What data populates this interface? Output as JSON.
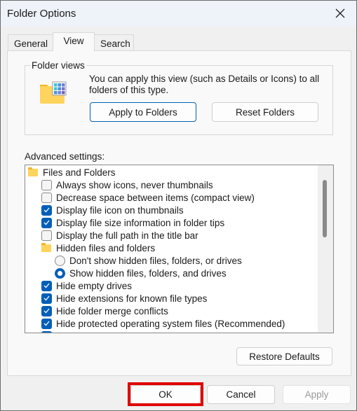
{
  "window": {
    "title": "Folder Options",
    "close_icon": "close-icon"
  },
  "tabs": [
    {
      "label": "General"
    },
    {
      "label": "View",
      "active": true
    },
    {
      "label": "Search"
    }
  ],
  "folder_views": {
    "label": "Folder views",
    "description": "You can apply this view (such as Details or Icons) to all folders of this type.",
    "apply_label": "Apply to Folders",
    "reset_label": "Reset Folders"
  },
  "advanced": {
    "label": "Advanced settings:",
    "items": [
      {
        "type": "folder",
        "label": "Files and Folders",
        "level": 0
      },
      {
        "type": "checkbox",
        "label": "Always show icons, never thumbnails",
        "checked": false,
        "level": 1
      },
      {
        "type": "checkbox",
        "label": "Decrease space between items (compact view)",
        "checked": false,
        "level": 1
      },
      {
        "type": "checkbox",
        "label": "Display file icon on thumbnails",
        "checked": true,
        "level": 1
      },
      {
        "type": "checkbox",
        "label": "Display file size information in folder tips",
        "checked": true,
        "level": 1
      },
      {
        "type": "checkbox",
        "label": "Display the full path in the title bar",
        "checked": false,
        "level": 1
      },
      {
        "type": "folder",
        "label": "Hidden files and folders",
        "level": 1
      },
      {
        "type": "radio",
        "label": "Don't show hidden files, folders, or drives",
        "checked": false,
        "level": 2
      },
      {
        "type": "radio",
        "label": "Show hidden files, folders, and drives",
        "checked": true,
        "level": 2
      },
      {
        "type": "checkbox",
        "label": "Hide empty drives",
        "checked": true,
        "level": 1
      },
      {
        "type": "checkbox",
        "label": "Hide extensions for known file types",
        "checked": true,
        "level": 1
      },
      {
        "type": "checkbox",
        "label": "Hide folder merge conflicts",
        "checked": true,
        "level": 1
      },
      {
        "type": "checkbox",
        "label": "Hide protected operating system files (Recommended)",
        "checked": true,
        "level": 1
      },
      {
        "type": "checkbox",
        "label": "",
        "checked": true,
        "level": 1
      }
    ]
  },
  "restore_label": "Restore Defaults",
  "footer": {
    "ok_label": "OK",
    "cancel_label": "Cancel",
    "apply_label": "Apply"
  },
  "colors": {
    "accent": "#005fb8",
    "highlight": "#e00000"
  }
}
